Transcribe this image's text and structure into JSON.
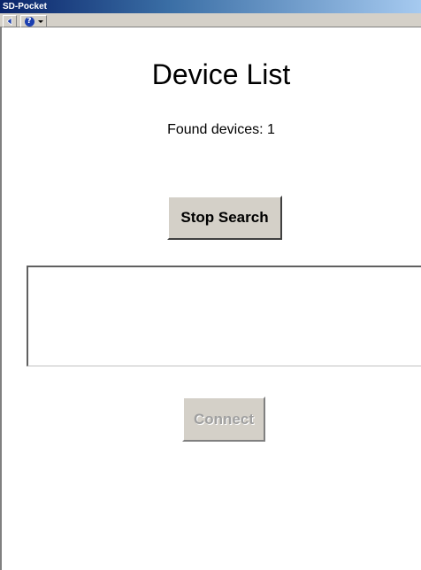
{
  "window": {
    "title": "SD-Pocket"
  },
  "toolbar": {
    "back_icon": "back-arrow-icon",
    "help_icon": "help-icon"
  },
  "page": {
    "title": "Device List",
    "status": "Found devices: 1"
  },
  "buttons": {
    "stop_search": "Stop Search",
    "connect": "Connect"
  },
  "device_list": {
    "items": []
  },
  "colors": {
    "titlebar_start": "#0a246a",
    "button_face": "#d4d0c8",
    "disabled_text": "#a0a0a0"
  }
}
